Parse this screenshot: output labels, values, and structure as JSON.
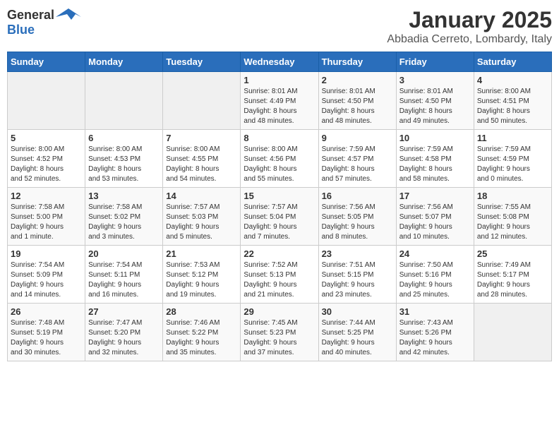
{
  "header": {
    "logo_general": "General",
    "logo_blue": "Blue",
    "month_year": "January 2025",
    "location": "Abbadia Cerreto, Lombardy, Italy"
  },
  "days_of_week": [
    "Sunday",
    "Monday",
    "Tuesday",
    "Wednesday",
    "Thursday",
    "Friday",
    "Saturday"
  ],
  "weeks": [
    [
      {
        "day": "",
        "info": ""
      },
      {
        "day": "",
        "info": ""
      },
      {
        "day": "",
        "info": ""
      },
      {
        "day": "1",
        "info": "Sunrise: 8:01 AM\nSunset: 4:49 PM\nDaylight: 8 hours\nand 48 minutes."
      },
      {
        "day": "2",
        "info": "Sunrise: 8:01 AM\nSunset: 4:50 PM\nDaylight: 8 hours\nand 48 minutes."
      },
      {
        "day": "3",
        "info": "Sunrise: 8:01 AM\nSunset: 4:50 PM\nDaylight: 8 hours\nand 49 minutes."
      },
      {
        "day": "4",
        "info": "Sunrise: 8:00 AM\nSunset: 4:51 PM\nDaylight: 8 hours\nand 50 minutes."
      }
    ],
    [
      {
        "day": "5",
        "info": "Sunrise: 8:00 AM\nSunset: 4:52 PM\nDaylight: 8 hours\nand 52 minutes."
      },
      {
        "day": "6",
        "info": "Sunrise: 8:00 AM\nSunset: 4:53 PM\nDaylight: 8 hours\nand 53 minutes."
      },
      {
        "day": "7",
        "info": "Sunrise: 8:00 AM\nSunset: 4:55 PM\nDaylight: 8 hours\nand 54 minutes."
      },
      {
        "day": "8",
        "info": "Sunrise: 8:00 AM\nSunset: 4:56 PM\nDaylight: 8 hours\nand 55 minutes."
      },
      {
        "day": "9",
        "info": "Sunrise: 7:59 AM\nSunset: 4:57 PM\nDaylight: 8 hours\nand 57 minutes."
      },
      {
        "day": "10",
        "info": "Sunrise: 7:59 AM\nSunset: 4:58 PM\nDaylight: 8 hours\nand 58 minutes."
      },
      {
        "day": "11",
        "info": "Sunrise: 7:59 AM\nSunset: 4:59 PM\nDaylight: 9 hours\nand 0 minutes."
      }
    ],
    [
      {
        "day": "12",
        "info": "Sunrise: 7:58 AM\nSunset: 5:00 PM\nDaylight: 9 hours\nand 1 minute."
      },
      {
        "day": "13",
        "info": "Sunrise: 7:58 AM\nSunset: 5:02 PM\nDaylight: 9 hours\nand 3 minutes."
      },
      {
        "day": "14",
        "info": "Sunrise: 7:57 AM\nSunset: 5:03 PM\nDaylight: 9 hours\nand 5 minutes."
      },
      {
        "day": "15",
        "info": "Sunrise: 7:57 AM\nSunset: 5:04 PM\nDaylight: 9 hours\nand 7 minutes."
      },
      {
        "day": "16",
        "info": "Sunrise: 7:56 AM\nSunset: 5:05 PM\nDaylight: 9 hours\nand 8 minutes."
      },
      {
        "day": "17",
        "info": "Sunrise: 7:56 AM\nSunset: 5:07 PM\nDaylight: 9 hours\nand 10 minutes."
      },
      {
        "day": "18",
        "info": "Sunrise: 7:55 AM\nSunset: 5:08 PM\nDaylight: 9 hours\nand 12 minutes."
      }
    ],
    [
      {
        "day": "19",
        "info": "Sunrise: 7:54 AM\nSunset: 5:09 PM\nDaylight: 9 hours\nand 14 minutes."
      },
      {
        "day": "20",
        "info": "Sunrise: 7:54 AM\nSunset: 5:11 PM\nDaylight: 9 hours\nand 16 minutes."
      },
      {
        "day": "21",
        "info": "Sunrise: 7:53 AM\nSunset: 5:12 PM\nDaylight: 9 hours\nand 19 minutes."
      },
      {
        "day": "22",
        "info": "Sunrise: 7:52 AM\nSunset: 5:13 PM\nDaylight: 9 hours\nand 21 minutes."
      },
      {
        "day": "23",
        "info": "Sunrise: 7:51 AM\nSunset: 5:15 PM\nDaylight: 9 hours\nand 23 minutes."
      },
      {
        "day": "24",
        "info": "Sunrise: 7:50 AM\nSunset: 5:16 PM\nDaylight: 9 hours\nand 25 minutes."
      },
      {
        "day": "25",
        "info": "Sunrise: 7:49 AM\nSunset: 5:17 PM\nDaylight: 9 hours\nand 28 minutes."
      }
    ],
    [
      {
        "day": "26",
        "info": "Sunrise: 7:48 AM\nSunset: 5:19 PM\nDaylight: 9 hours\nand 30 minutes."
      },
      {
        "day": "27",
        "info": "Sunrise: 7:47 AM\nSunset: 5:20 PM\nDaylight: 9 hours\nand 32 minutes."
      },
      {
        "day": "28",
        "info": "Sunrise: 7:46 AM\nSunset: 5:22 PM\nDaylight: 9 hours\nand 35 minutes."
      },
      {
        "day": "29",
        "info": "Sunrise: 7:45 AM\nSunset: 5:23 PM\nDaylight: 9 hours\nand 37 minutes."
      },
      {
        "day": "30",
        "info": "Sunrise: 7:44 AM\nSunset: 5:25 PM\nDaylight: 9 hours\nand 40 minutes."
      },
      {
        "day": "31",
        "info": "Sunrise: 7:43 AM\nSunset: 5:26 PM\nDaylight: 9 hours\nand 42 minutes."
      },
      {
        "day": "",
        "info": ""
      }
    ]
  ]
}
